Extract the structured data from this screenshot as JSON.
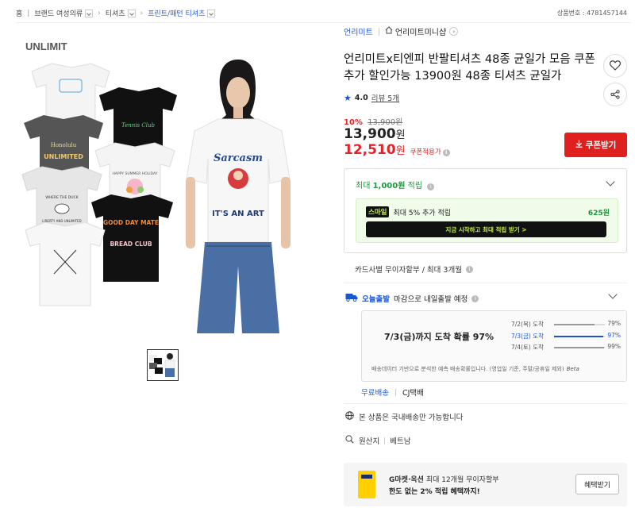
{
  "breadcrumb": {
    "home": "홈",
    "items": [
      "브랜드 여성의류",
      "티셔츠",
      "프린트/패턴 티셔츠"
    ]
  },
  "product_number": "상품번호 : 4781457144",
  "gallery": {
    "brand_logo": "UNLIMIT",
    "model_shirt_text": [
      "Sarcasm",
      "IT'S AN ART"
    ],
    "shirt_prints": [
      "Tennis Club",
      "Honolulu",
      "UNLIMITED",
      "WHERE THE DUCK",
      "LIBERTY AND UNLIMITED",
      "HAPPY SUMMER HOLIDAY",
      "GOOD DAY MATE",
      "BREAD CLUB"
    ]
  },
  "shop": {
    "brand": "언리미트",
    "store": "언리미트미니샵"
  },
  "title": "언리미트x티엔피 반팔티셔츠 48종 균일가 모음 쿠폰추가 할인가능 13900원 48종 티셔츠 균일가",
  "rating": {
    "score": "4.0",
    "reviews": "리뷰 5개"
  },
  "price": {
    "discount_pct": "10%",
    "original": "13,900원",
    "sale": "13,900",
    "coupon_price": "12,510",
    "won": "원",
    "coupon_label": "쿠폰적용가",
    "coupon_button": "쿠폰받기"
  },
  "points": {
    "max_label": "최대",
    "max_amount": "1,000원",
    "suffix": "적립",
    "smile_badge": "스마일",
    "smile_text": "최대 5% 추가 적립",
    "smile_amount": "625원",
    "smile_cta": "지금 시작하고 최대 적립 받기  >"
  },
  "card_info": "카드사별 무이자할부 / 최대 3개월",
  "delivery": {
    "badge": "오늘출발",
    "text": "마감으로 내일출발 예정",
    "headline": "7/3(금)까지 도착 확률 97%",
    "rows": [
      {
        "date": "7/2(목) 도착",
        "pct": "79%",
        "value": 79,
        "active": false
      },
      {
        "date": "7/3(금) 도착",
        "pct": "97%",
        "value": 97,
        "active": true
      },
      {
        "date": "7/4(토) 도착",
        "pct": "99%",
        "value": 99,
        "active": false
      }
    ],
    "note": "배송데이터 기반으로 분석한 예측 배송확률입니다. (영업일 기준, 주말/공휴일 제외)",
    "beta": "Beta"
  },
  "shipping": {
    "free": "무료배송",
    "carrier": "CJ택배"
  },
  "domestic": "본 상품은 국내배송만 가능합니다",
  "origin": {
    "label": "원산지",
    "value": "베트남"
  },
  "promo": {
    "line1_bold": "G마켓·옥션",
    "line1": "최대 12개월 무이자할부",
    "line2": "한도 없는 2% 적립 혜택까지!",
    "button": "혜택받기"
  }
}
